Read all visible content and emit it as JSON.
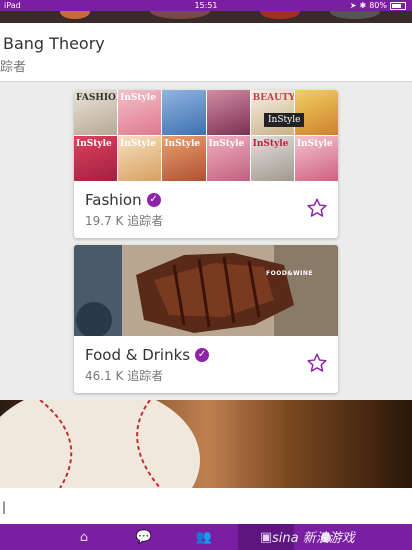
{
  "status_bar": {
    "carrier": "iPad",
    "time": "15:51",
    "battery": "80%",
    "icons": [
      "wifi-icon",
      "location-icon",
      "bluetooth-icon",
      "battery-icon"
    ]
  },
  "partial_card": {
    "title": "Bang Theory",
    "subtitle": "踪者"
  },
  "cards": [
    {
      "name": "Fashion",
      "followers": "19.7 K 追踪者",
      "verified": true,
      "image_text": "InStyle",
      "collage_logos": [
        "FASHION",
        "InStyle",
        "",
        "",
        "BEAUTY",
        "",
        "InStyle",
        "InStyle",
        "InStyle",
        "InStyle",
        "InStyle",
        "InStyle"
      ]
    },
    {
      "name": "Food & Drinks",
      "followers": "46.1 K 追踪者",
      "verified": true,
      "image_text": "FOOD&WINE"
    }
  ],
  "bottom_card": {
    "text": "|"
  },
  "tab_bar": {
    "tabs": [
      "home-icon",
      "chat-icon",
      "people-icon",
      "explore-icon",
      "profile-icon"
    ],
    "active_index": 3,
    "watermark": "sina 新浪游戏"
  },
  "colors": {
    "accent": "#7b1fa2",
    "verified": "#8e24aa"
  }
}
